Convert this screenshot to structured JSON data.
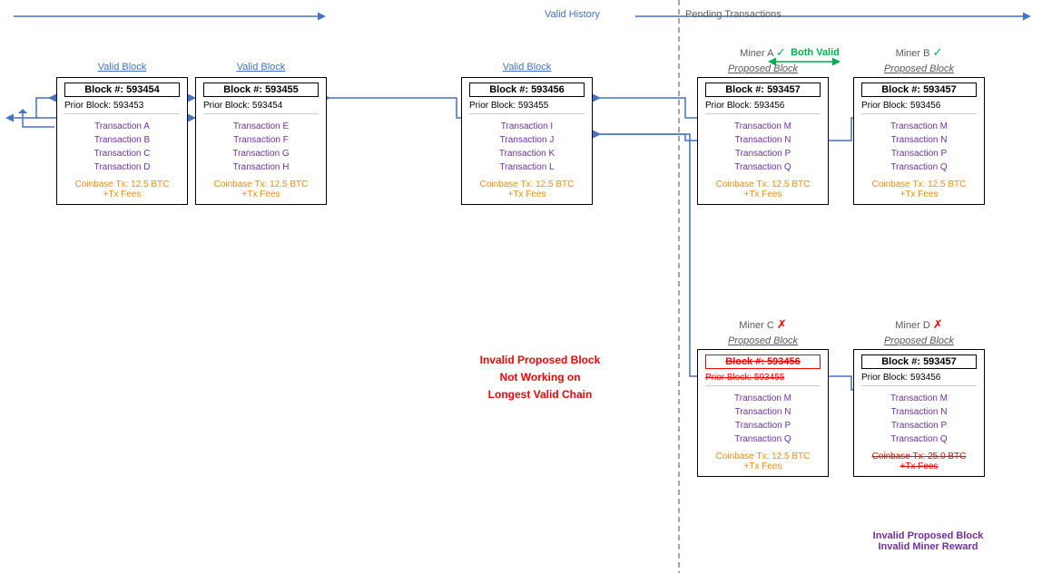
{
  "diagram": {
    "valid_history": "Valid History",
    "pending_transactions": "Pending Transactions",
    "both_valid": "Both Valid",
    "blocks": {
      "b1": {
        "label": "Valid Block",
        "number": "Block #: 593454",
        "prior": "Prior Block: 593453",
        "transactions": [
          "Transaction A",
          "Transaction B",
          "Transaction C",
          "Transaction D"
        ],
        "coinbase": "Coinbase Tx: 12.5 BTC\n+Tx Fees"
      },
      "b2": {
        "label": "Valid Block",
        "number": "Block #: 593455",
        "prior": "Prior Block: 593454",
        "transactions": [
          "Transaction E",
          "Transaction F",
          "Transaction G",
          "Transaction H"
        ],
        "coinbase": "Coinbase Tx: 12.5 BTC\n+Tx Fees"
      },
      "b3": {
        "label": "Valid Block",
        "number": "Block #: 593456",
        "prior": "Prior Block: 593455",
        "transactions": [
          "Transaction I",
          "Transaction J",
          "Transaction K",
          "Transaction L"
        ],
        "coinbase": "Coinbase Tx: 12.5 BTC\n+Tx Fees"
      },
      "b4": {
        "label": "Miner A ✓\nProposed Block",
        "number": "Block #: 593457",
        "prior": "Prior Block: 593456",
        "transactions": [
          "Transaction M",
          "Transaction N",
          "Transaction P",
          "Transaction Q"
        ],
        "coinbase": "Coinbase Tx: 12.5 BTC\n+Tx Fees"
      },
      "b5": {
        "label": "Miner B ✓\nProposed Block",
        "number": "Block #: 593457",
        "prior": "Prior Block: 593456",
        "transactions": [
          "Transaction M",
          "Transaction N",
          "Transaction P",
          "Transaction Q"
        ],
        "coinbase": "Coinbase Tx: 12.5 BTC\n+Tx Fees"
      },
      "b6": {
        "label": "Miner C ✗\nProposed Block",
        "number": "Block #: 593456",
        "prior": "Prior Block: 593455",
        "transactions": [
          "Transaction M",
          "Transaction N",
          "Transaction P",
          "Transaction Q"
        ],
        "coinbase": "Coinbase Tx: 12.5 BTC\n+Tx Fees",
        "invalid": true,
        "number_strikethrough": true,
        "prior_strikethrough": true
      },
      "b7": {
        "label": "Miner D ✗\nProposed Block",
        "number": "Block #: 593457",
        "prior": "Prior Block: 593456",
        "transactions": [
          "Transaction M",
          "Transaction N",
          "Transaction P",
          "Transaction Q"
        ],
        "coinbase": "Coinbase Tx: 25.0 BTC\n+Tx Fees",
        "invalid": true,
        "coinbase_strikethrough": true
      }
    },
    "invalid_labels": {
      "label1": "Invalid Proposed Block",
      "label2": "Not Working on\nLongest Valid Chain",
      "label3": "Invalid Proposed Block\nInvalid Miner Reward"
    }
  }
}
